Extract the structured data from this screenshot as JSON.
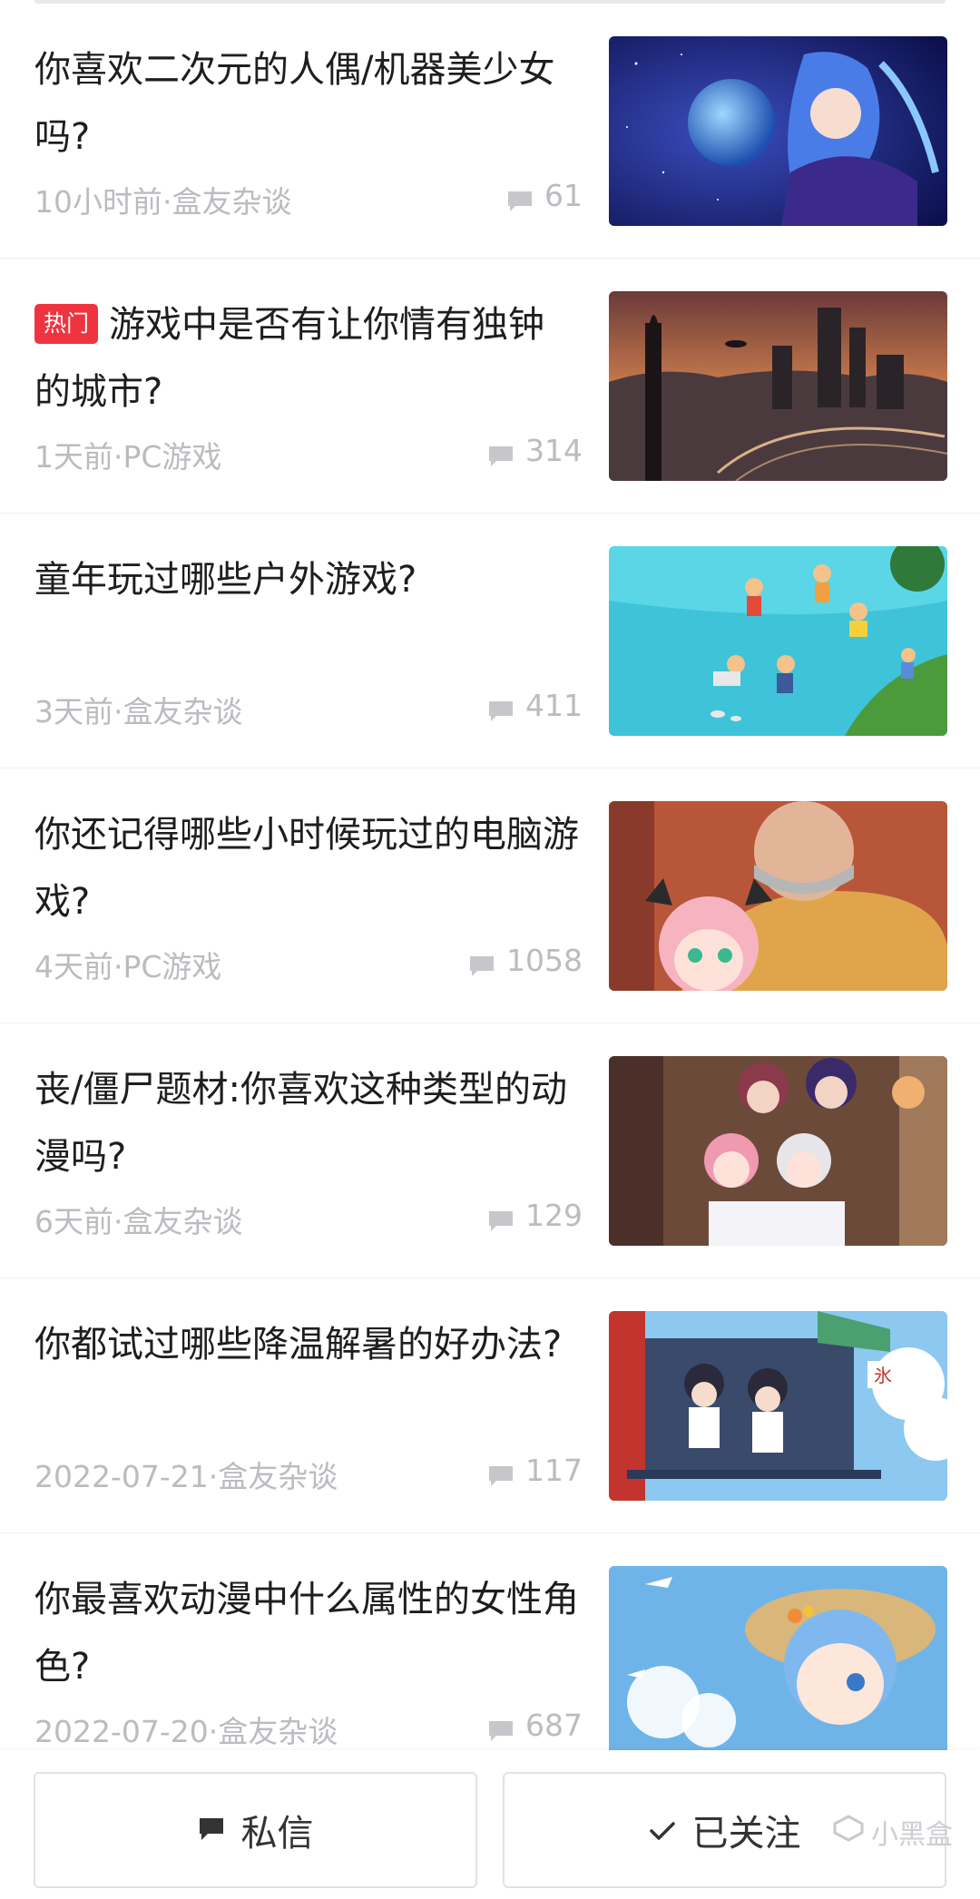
{
  "feed": [
    {
      "title": "你喜欢二次元的人偶/机器美少女吗?",
      "badge": "",
      "meta": "10小时前·盒友杂谈",
      "comments": "61",
      "thumb": "anime-girl-earth-icon"
    },
    {
      "title": "游戏中是否有让你情有独钟的城市?",
      "badge": "热门",
      "meta": "1天前·PC游戏",
      "comments": "314",
      "thumb": "city-sunset-icon"
    },
    {
      "title": "童年玩过哪些户外游戏?",
      "badge": "",
      "meta": "3天前·盒友杂谈",
      "comments": "411",
      "thumb": "kids-water-icon"
    },
    {
      "title": "你还记得哪些小时候玩过的电脑游戏?",
      "badge": "",
      "meta": "4天前·PC游戏",
      "comments": "1058",
      "thumb": "anime-old-man-icon"
    },
    {
      "title": "丧/僵尸题材:你喜欢这种类型的动漫吗?",
      "badge": "",
      "meta": "6天前·盒友杂谈",
      "comments": "129",
      "thumb": "anime-group-icon"
    },
    {
      "title": "你都试过哪些降温解暑的好办法?",
      "badge": "",
      "meta": "2022-07-21·盒友杂谈",
      "comments": "117",
      "thumb": "anime-summer-icon"
    },
    {
      "title": "你最喜欢动漫中什么属性的女性角色?",
      "badge": "",
      "meta": "2022-07-20·盒友杂谈",
      "comments": "687",
      "thumb": "anime-straw-hat-icon"
    }
  ],
  "bottom": {
    "message_label": "私信",
    "follow_label": "已关注",
    "watermark": "小黑盒"
  }
}
